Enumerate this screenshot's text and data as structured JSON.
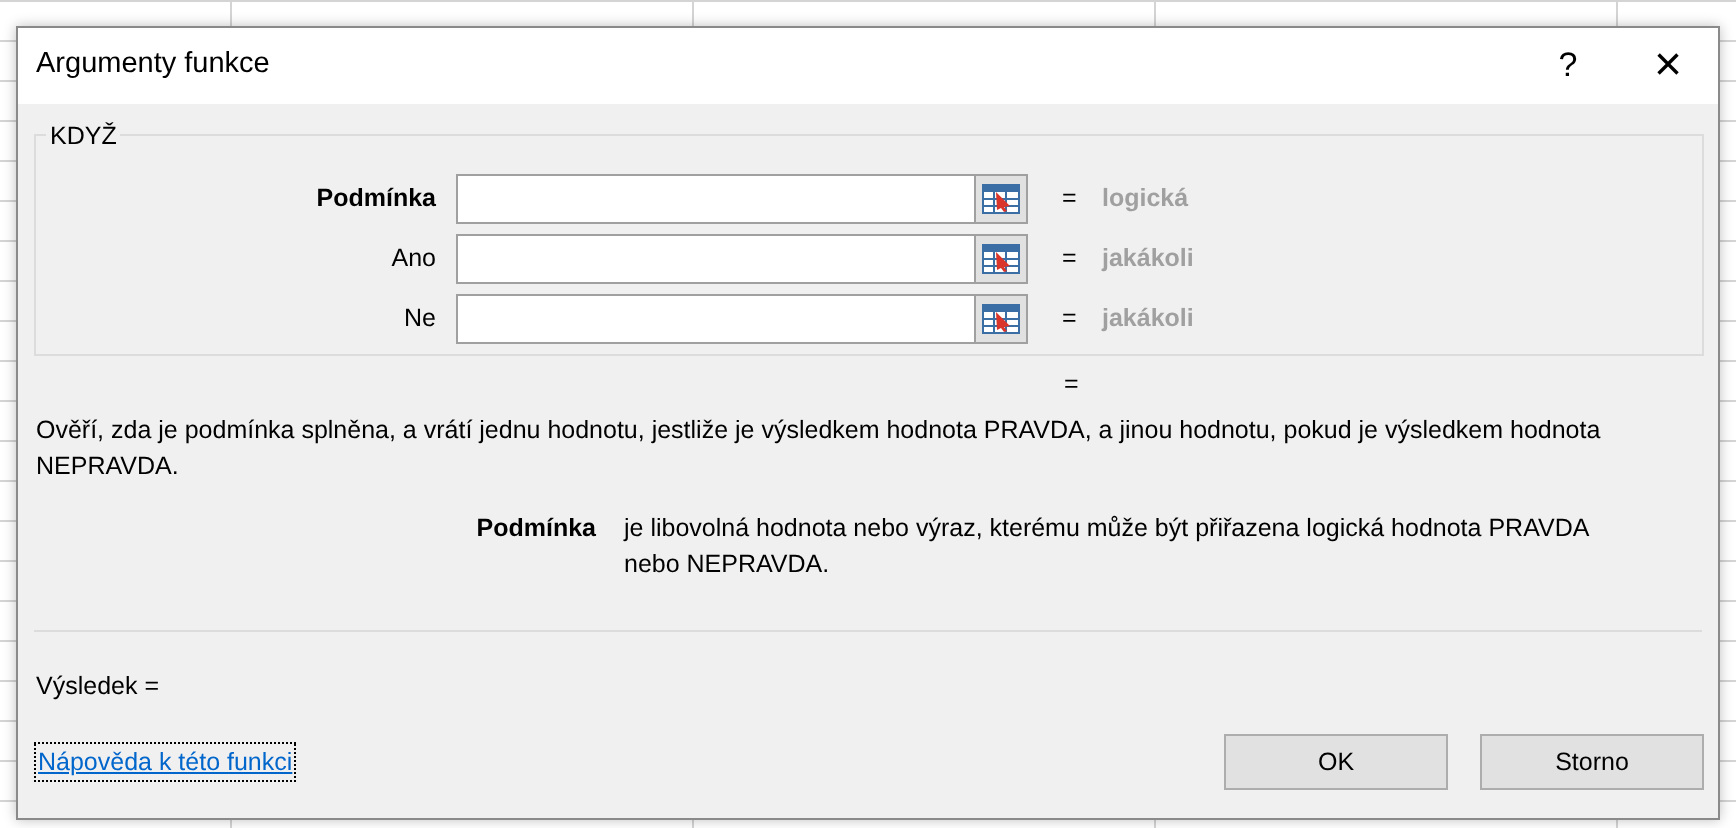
{
  "window": {
    "title": "Argumenty funkce",
    "help_button": "?",
    "close_button": "×"
  },
  "function_group": {
    "name": "KDYŽ",
    "arguments": [
      {
        "label": "Podmínka",
        "required": true,
        "equals": "=",
        "result": "logická"
      },
      {
        "label": "Ano",
        "required": false,
        "equals": "=",
        "result": "jakákoli"
      },
      {
        "label": "Ne",
        "required": false,
        "equals": "=",
        "result": "jakákoli"
      }
    ]
  },
  "formula_equals": "=",
  "description": "Ověří, zda je podmínka splněna, a vrátí jednu hodnotu, jestliže je výsledkem hodnota PRAVDA, a jinou hodnotu, pokud je výsledkem hodnota NEPRAVDA.",
  "argument_help": {
    "label": "Podmínka",
    "text": "je libovolná hodnota nebo výraz, kterému může být přiřazena logická hodnota PRAVDA nebo NEPRAVDA."
  },
  "result": "Výsledek =",
  "help_link": "Nápověda k této funkci",
  "buttons": [
    "OK",
    "Storno"
  ]
}
